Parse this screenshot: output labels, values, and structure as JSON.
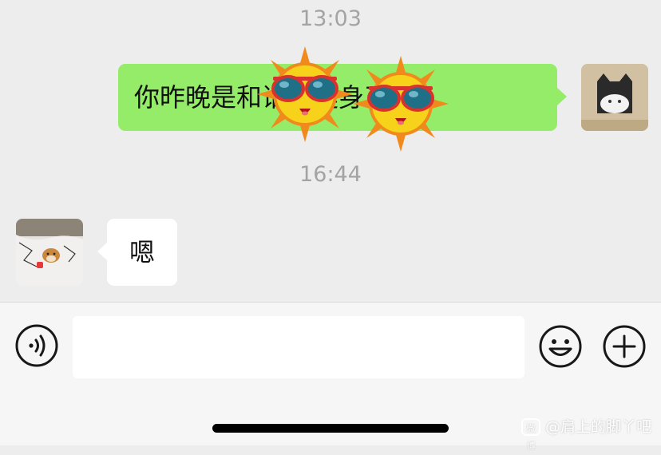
{
  "chat": {
    "timestamps": [
      "13:03",
      "16:44"
    ],
    "messages": [
      {
        "side": "outgoing",
        "text": "你昨晚是和谁去健身了吗"
      },
      {
        "side": "incoming",
        "text": "嗯"
      }
    ],
    "stickers": [
      "sun-with-sunglasses",
      "sun-with-sunglasses"
    ]
  },
  "input_bar": {
    "voice_icon": "voice-icon",
    "emoji_icon": "emoji-icon",
    "plus_icon": "plus-icon",
    "text_value": ""
  },
  "watermark": {
    "badge": "微博",
    "text": "@肩上的脚丫吧"
  },
  "colors": {
    "background": "#ededed",
    "outgoing_bubble": "#95ec69",
    "incoming_bubble": "#ffffff",
    "timestamp": "#a3a3a3",
    "input_bar": "#f6f6f6"
  }
}
